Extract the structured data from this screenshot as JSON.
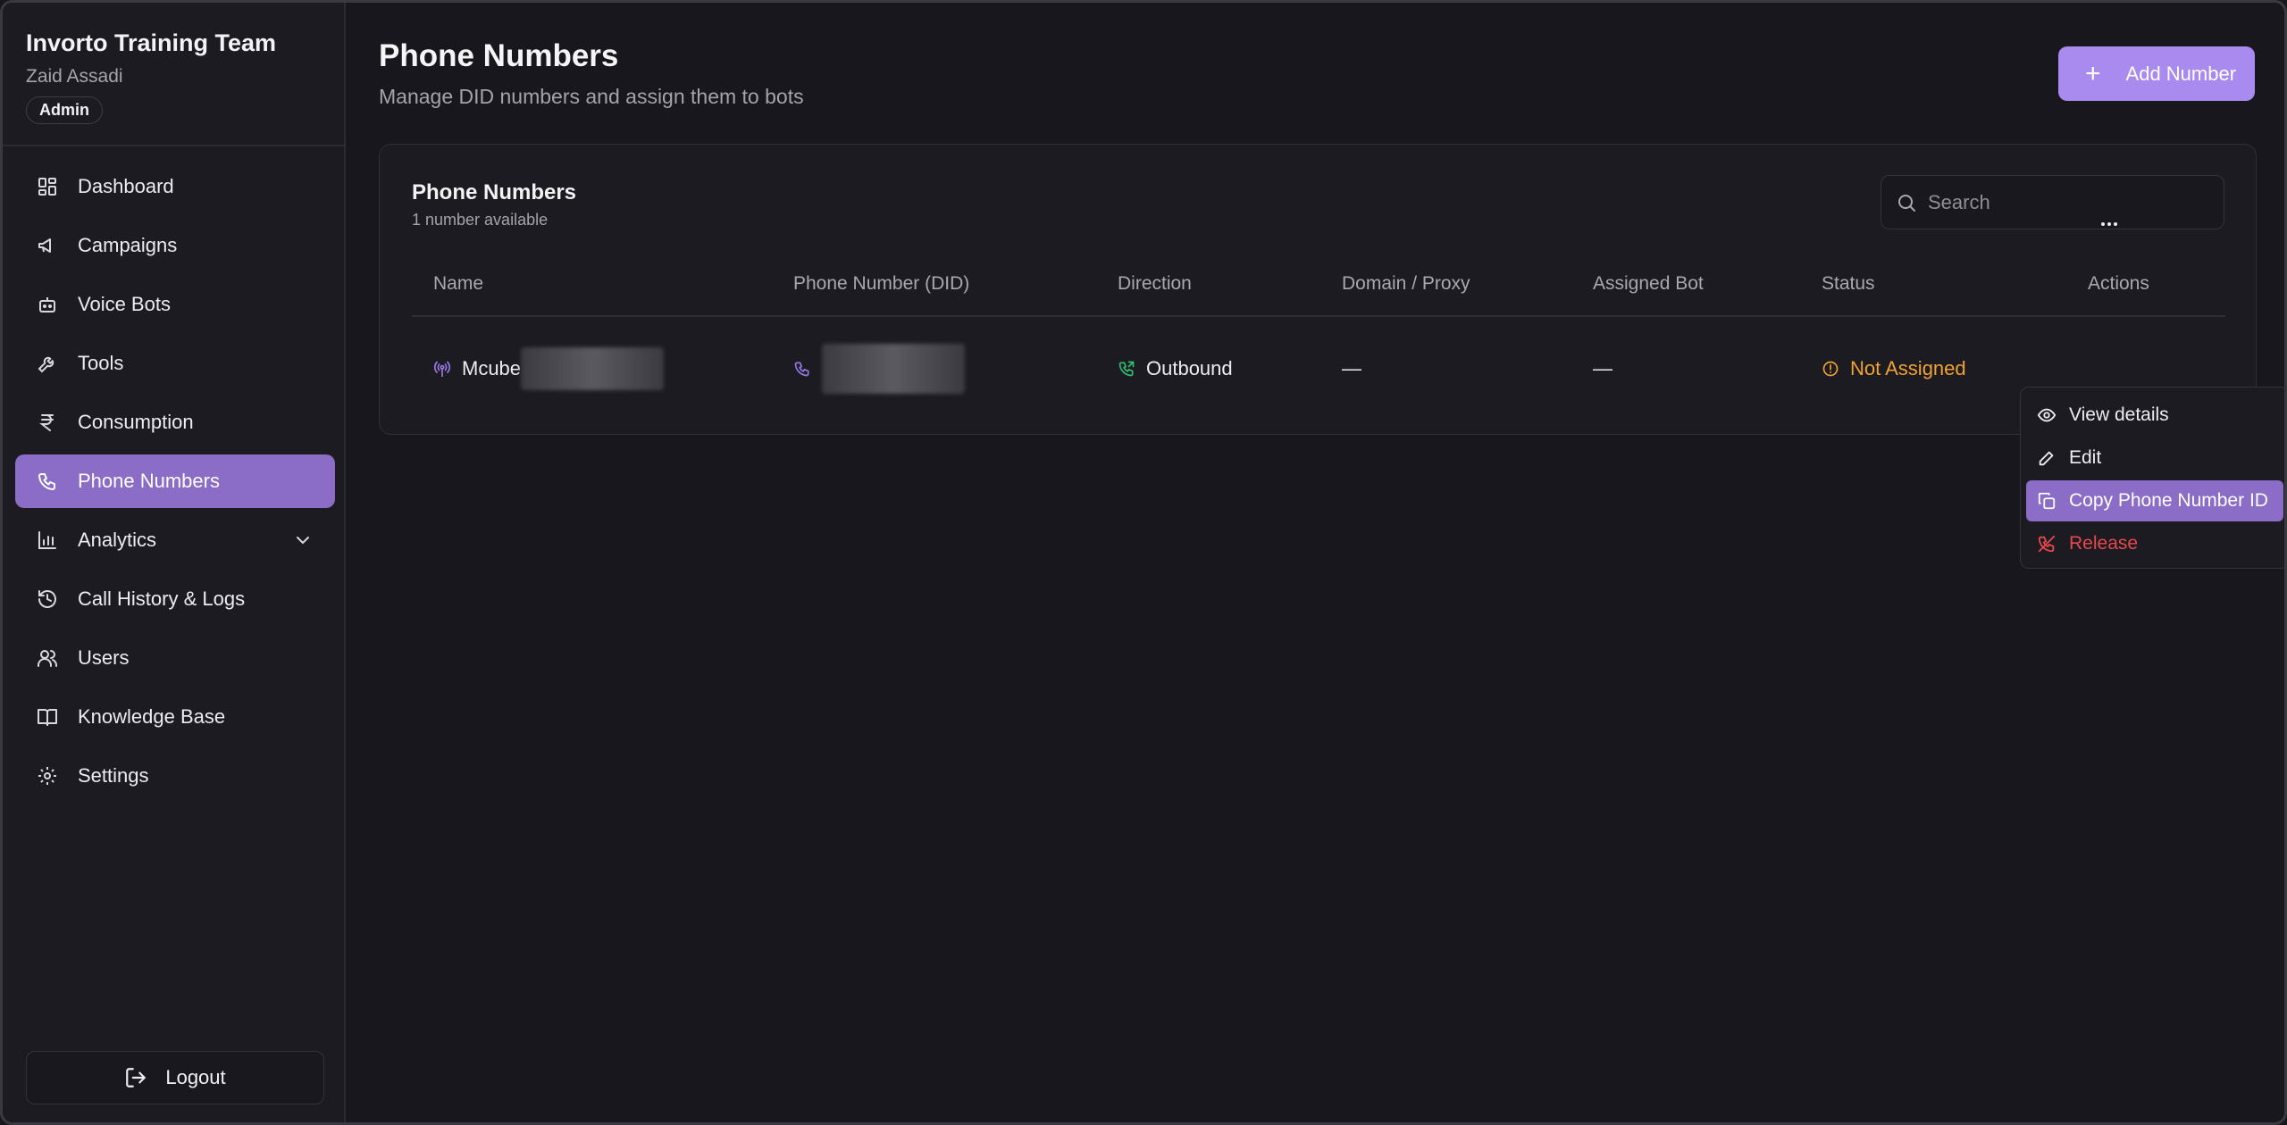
{
  "sidebar": {
    "org_name": "Invorto Training Team",
    "user_name": "Zaid Assadi",
    "role": "Admin",
    "items": [
      {
        "label": "Dashboard",
        "icon": "dashboard-icon"
      },
      {
        "label": "Campaigns",
        "icon": "megaphone-icon"
      },
      {
        "label": "Voice Bots",
        "icon": "bot-icon"
      },
      {
        "label": "Tools",
        "icon": "wrench-icon"
      },
      {
        "label": "Consumption",
        "icon": "rupee-icon"
      },
      {
        "label": "Phone Numbers",
        "icon": "phone-icon",
        "active": true
      },
      {
        "label": "Analytics",
        "icon": "bar-chart-icon",
        "expandable": true
      },
      {
        "label": "Call History & Logs",
        "icon": "history-icon"
      },
      {
        "label": "Users",
        "icon": "users-icon"
      },
      {
        "label": "Knowledge Base",
        "icon": "book-icon"
      },
      {
        "label": "Settings",
        "icon": "gear-icon"
      }
    ],
    "logout_label": "Logout"
  },
  "header": {
    "title": "Phone Numbers",
    "subtitle": "Manage DID numbers and assign them to bots",
    "add_button_label": "Add Number"
  },
  "card": {
    "title": "Phone Numbers",
    "subtitle": "1 number available",
    "search_placeholder": "Search"
  },
  "table": {
    "columns": [
      "Name",
      "Phone Number (DID)",
      "Direction",
      "Domain / Proxy",
      "Assigned Bot",
      "Status",
      "Actions"
    ],
    "rows": [
      {
        "name": "Mcube",
        "direction": "Outbound",
        "domain_proxy": "—",
        "assigned_bot": "—",
        "status": "Not Assigned"
      }
    ]
  },
  "actions_menu": {
    "items": [
      "View details",
      "Edit",
      "Copy Phone Number ID",
      "Release"
    ]
  },
  "colors": {
    "accent": "#8b6cc6",
    "button": "#a98aee",
    "status_warning": "#f0a232",
    "danger": "#e5484d",
    "outbound": "#2fbf71"
  }
}
